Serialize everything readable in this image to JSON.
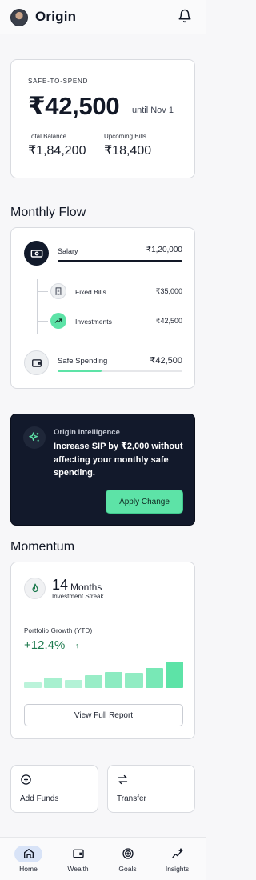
{
  "header": {
    "title": "Origin",
    "avatar": "user-avatar",
    "notification_icon": "bell-icon"
  },
  "safe_to_spend": {
    "eyebrow": "SAFE-TO-SPEND",
    "amount": "₹42,500",
    "until": "until Nov 1",
    "total_balance_label": "Total Balance",
    "total_balance": "₹1,84,200",
    "upcoming_bills_label": "Upcoming Bills",
    "upcoming_bills": "₹18,400"
  },
  "monthly_flow": {
    "title": "Monthly Flow",
    "items": [
      {
        "label": "Salary",
        "value": "₹1,20,000",
        "icon": "banknote-icon",
        "progress": 1.0
      },
      {
        "label": "Fixed Bills",
        "value": "₹35,000",
        "icon": "receipt-icon"
      },
      {
        "label": "Investments",
        "value": "₹42,500",
        "icon": "trending-up-icon"
      },
      {
        "label": "Safe Spending",
        "value": "₹42,500",
        "icon": "wallet-icon",
        "progress": 0.35
      }
    ]
  },
  "intelligence": {
    "eyebrow": "Origin Intelligence",
    "message": "Increase SIP by ₹2,000 without affecting your monthly safe spending.",
    "action": "Apply Change",
    "icon": "sparkles-icon"
  },
  "momentum": {
    "title": "Momentum",
    "streak_value": "14",
    "streak_unit": "Months",
    "streak_label": "Investment Streak",
    "streak_icon": "flame-icon",
    "growth_label": "Portfolio Growth (YTD)",
    "growth_value": "+12.4%",
    "growth_arrow": "↑",
    "report_button": "View Full Report"
  },
  "chart_data": {
    "type": "bar",
    "title": "Portfolio Growth (YTD)",
    "categories": [],
    "values": [
      0.22,
      0.38,
      0.3,
      0.5,
      0.62,
      0.58,
      0.77,
      1.0
    ]
  },
  "quick_actions": [
    {
      "label": "Add Funds",
      "icon": "plus-circle-icon"
    },
    {
      "label": "Transfer",
      "icon": "transfer-arrows-icon"
    }
  ],
  "tabs": [
    {
      "label": "Home",
      "icon": "home-icon",
      "active": true
    },
    {
      "label": "Wealth",
      "icon": "wallet-icon",
      "active": false
    },
    {
      "label": "Goals",
      "icon": "target-icon",
      "active": false
    },
    {
      "label": "Insights",
      "icon": "sparkline-icon",
      "active": false
    }
  ],
  "colors": {
    "accent": "#5de3a7",
    "dark_card": "#12192b",
    "positive": "#1d7a4e",
    "text": "#121826"
  }
}
